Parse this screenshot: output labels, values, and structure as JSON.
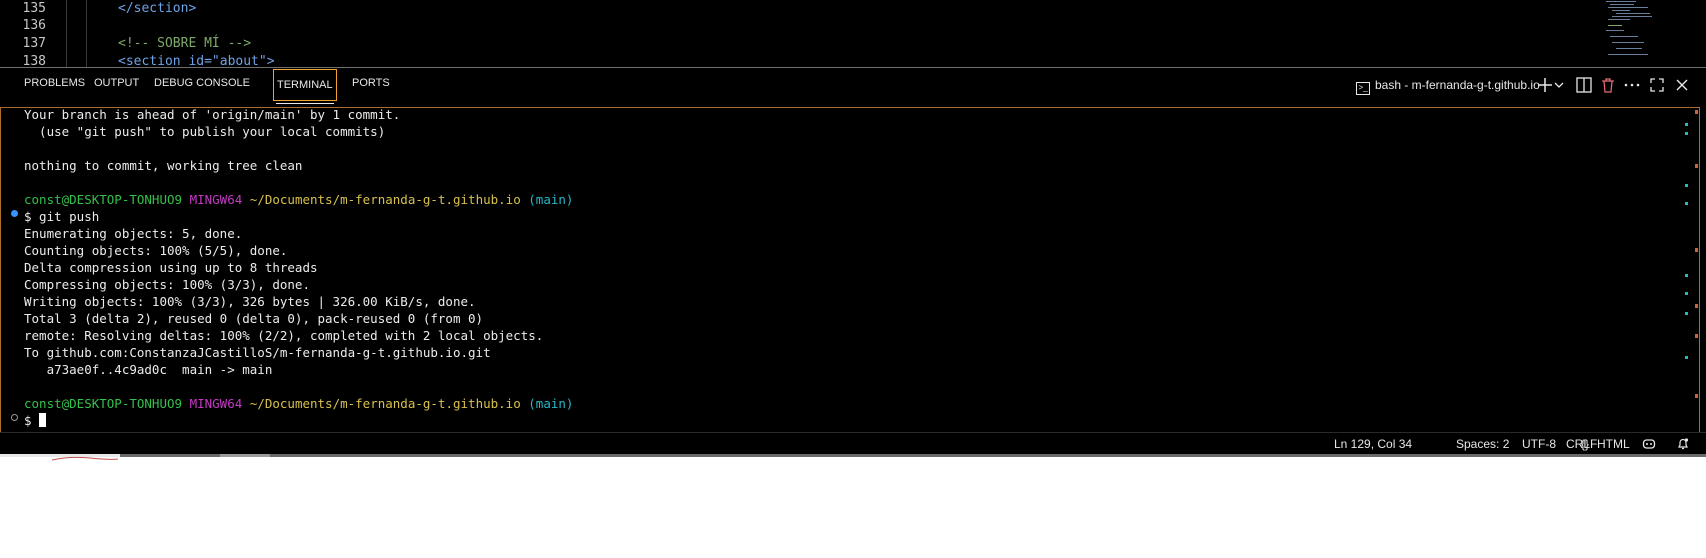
{
  "editor": {
    "lines": [
      {
        "num": "135",
        "code": "</section>"
      },
      {
        "num": "136",
        "code": ""
      },
      {
        "num": "137",
        "code": "<!-- SOBRE MÍ -->"
      },
      {
        "num": "138",
        "code": "<section id=\"about\">"
      }
    ]
  },
  "panel": {
    "tabs": [
      "PROBLEMS",
      "OUTPUT",
      "DEBUG CONSOLE",
      "TERMINAL",
      "PORTS"
    ],
    "active_tab": "TERMINAL",
    "terminal_name": "bash - m-fernanda-g-t.github.io"
  },
  "terminal": {
    "lines": [
      "Your branch is ahead of 'origin/main' by 1 commit.",
      "  (use \"git push\" to publish your local commits)",
      "",
      "nothing to commit, working tree clean",
      ""
    ],
    "prompt1": {
      "user": "const@DESKTOP-TONHUO9",
      "shell": "MINGW64",
      "path": "~/Documents/m-fernanda-g-t.github.io",
      "branch": "(main)"
    },
    "command": "$ git push",
    "output": [
      "Enumerating objects: 5, done.",
      "Counting objects: 100% (5/5), done.",
      "Delta compression using up to 8 threads",
      "Compressing objects: 100% (3/3), done.",
      "Writing objects: 100% (3/3), 326 bytes | 326.00 KiB/s, done.",
      "Total 3 (delta 2), reused 0 (delta 0), pack-reused 0 (from 0)",
      "remote: Resolving deltas: 100% (2/2), completed with 2 local objects.",
      "To github.com:ConstanzaJCastilloS/m-fernanda-g-t.github.io.git",
      "   a73ae0f..4c9ad0c  main -> main"
    ],
    "prompt2": {
      "user": "const@DESKTOP-TONHUO9",
      "shell": "MINGW64",
      "path": "~/Documents/m-fernanda-g-t.github.io",
      "branch": "(main)"
    },
    "current_prompt": "$ "
  },
  "statusbar": {
    "position": "Ln 129, Col 34",
    "spaces": "Spaces: 2",
    "encoding": "UTF-8",
    "eol": "CRLF",
    "language": "HTML"
  },
  "colors": {
    "background": "#000000",
    "user_green": "#33c04b",
    "shell_magenta": "#c33ac3",
    "path_yellow": "#d7c04b",
    "branch_cyan": "#27b7c9",
    "active_border": "#f0a030"
  }
}
